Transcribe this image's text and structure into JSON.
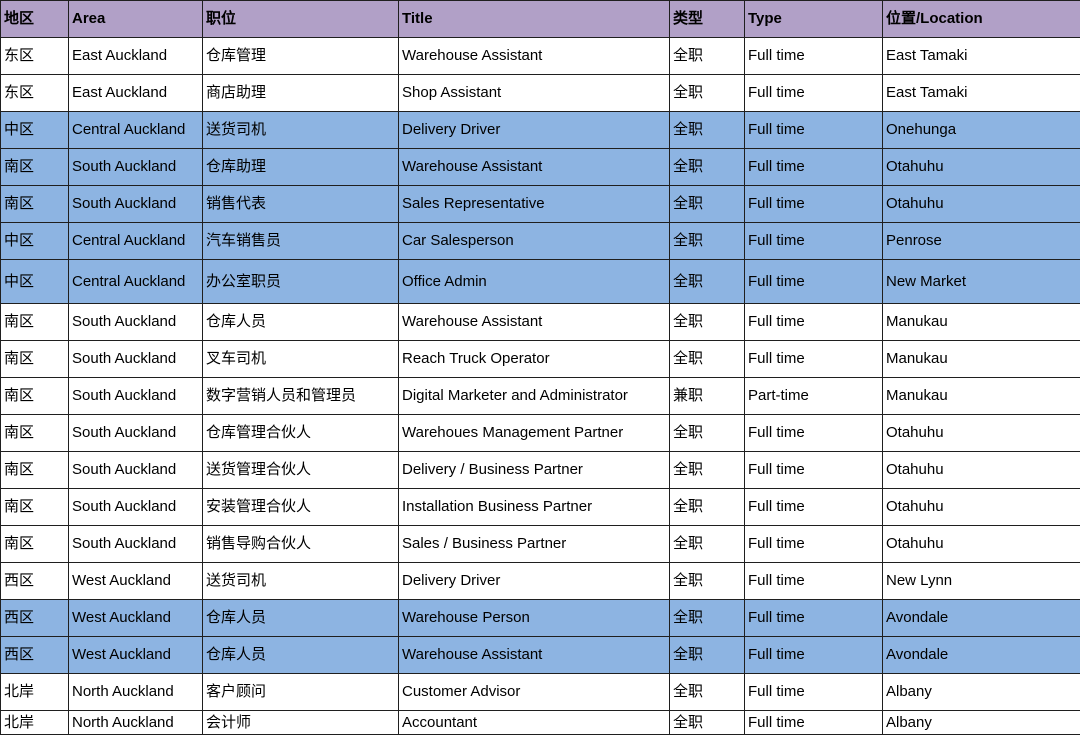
{
  "colors": {
    "header_bg": "#b1a0c7",
    "highlight_bg": "#8db4e2",
    "plain_bg": "#ffffff",
    "border": "#1f1f1f"
  },
  "table": {
    "headers": [
      "地区",
      "Area",
      "职位",
      "Title",
      "类型",
      "Type",
      "位置/Location"
    ],
    "rows": [
      {
        "highlight": false,
        "cells": [
          "东区",
          "East Auckland",
          "仓库管理",
          "Warehouse Assistant",
          "全职",
          "Full time",
          "East Tamaki"
        ]
      },
      {
        "highlight": false,
        "cells": [
          "东区",
          "East Auckland",
          "商店助理",
          "Shop Assistant",
          "全职",
          "Full time",
          "East Tamaki"
        ]
      },
      {
        "highlight": true,
        "cells": [
          "中区",
          "Central Auckland",
          "送货司机",
          "Delivery Driver",
          "全职",
          "Full time",
          "Onehunga"
        ]
      },
      {
        "highlight": true,
        "cells": [
          "南区",
          "South Auckland",
          "仓库助理",
          "Warehouse Assistant",
          "全职",
          "Full time",
          "Otahuhu"
        ]
      },
      {
        "highlight": true,
        "cells": [
          "南区",
          "South Auckland",
          "销售代表",
          "Sales Representative",
          "全职",
          "Full time",
          "Otahuhu"
        ]
      },
      {
        "highlight": true,
        "cells": [
          "中区",
          "Central Auckland",
          "汽车销售员",
          "Car Salesperson",
          "全职",
          "Full time",
          "Penrose"
        ]
      },
      {
        "highlight": true,
        "cells": [
          "中区",
          "Central Auckland",
          "办公室职员",
          "Office Admin",
          "全职",
          "Full time",
          "New Market"
        ]
      },
      {
        "highlight": false,
        "cells": [
          "南区",
          "South Auckland",
          "仓库人员",
          "Warehouse Assistant",
          "全职",
          "Full time",
          "Manukau"
        ]
      },
      {
        "highlight": false,
        "cells": [
          "南区",
          "South Auckland",
          "叉车司机",
          "Reach Truck Operator",
          "全职",
          "Full time",
          "Manukau"
        ]
      },
      {
        "highlight": false,
        "cells": [
          "南区",
          "South Auckland",
          "数字营销人员和管理员",
          "Digital Marketer and Administrator",
          "兼职",
          "Part-time",
          "Manukau"
        ]
      },
      {
        "highlight": false,
        "cells": [
          "南区",
          "South Auckland",
          "仓库管理合伙人",
          "Warehoues Management Partner",
          "全职",
          "Full time",
          "Otahuhu"
        ]
      },
      {
        "highlight": false,
        "cells": [
          "南区",
          "South Auckland",
          "送货管理合伙人",
          "Delivery / Business Partner",
          "全职",
          "Full time",
          "Otahuhu"
        ]
      },
      {
        "highlight": false,
        "cells": [
          "南区",
          "South Auckland",
          "安装管理合伙人",
          "Installation Business Partner",
          "全职",
          "Full time",
          "Otahuhu"
        ]
      },
      {
        "highlight": false,
        "cells": [
          "南区",
          "South Auckland",
          "销售导购合伙人",
          "Sales / Business Partner",
          "全职",
          "Full time",
          "Otahuhu"
        ]
      },
      {
        "highlight": false,
        "cells": [
          "西区",
          "West Auckland",
          "送货司机",
          "Delivery Driver",
          "全职",
          "Full time",
          "New Lynn"
        ]
      },
      {
        "highlight": true,
        "cells": [
          "西区",
          "West Auckland",
          "仓库人员",
          "Warehouse Person",
          "全职",
          "Full time",
          "Avondale"
        ]
      },
      {
        "highlight": true,
        "cells": [
          "西区",
          "West Auckland",
          "仓库人员",
          "Warehouse Assistant",
          "全职",
          "Full time",
          "Avondale"
        ]
      },
      {
        "highlight": false,
        "cells": [
          "北岸",
          "North Auckland",
          "客户顾问",
          "Customer Advisor",
          "全职",
          "Full time",
          "Albany"
        ]
      },
      {
        "highlight": false,
        "cells": [
          "北岸",
          "North Auckland",
          "会计师",
          "Accountant",
          "全职",
          "Full time",
          "Albany"
        ]
      }
    ]
  }
}
